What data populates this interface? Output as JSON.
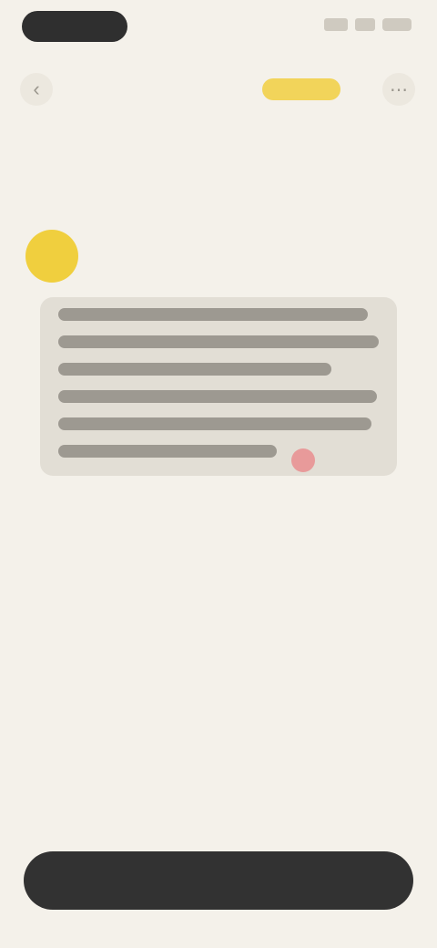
{
  "status_bar": {
    "icons": [
      "signal-icon",
      "wifi-icon",
      "battery-icon"
    ]
  },
  "top_nav": {
    "back_icon": "‹",
    "chip_label": "",
    "more_icon": "⋯"
  },
  "page": {
    "title": ""
  },
  "message": {
    "lines": 6,
    "marker_color": "#e89a9a"
  },
  "bottom_bar": {
    "left_label": "",
    "center_label": "",
    "right_label": ""
  },
  "colors": {
    "background": "#f4f1ea",
    "accent": "#f0cf3e",
    "card": "#e2ded5",
    "dark": "#323232"
  }
}
